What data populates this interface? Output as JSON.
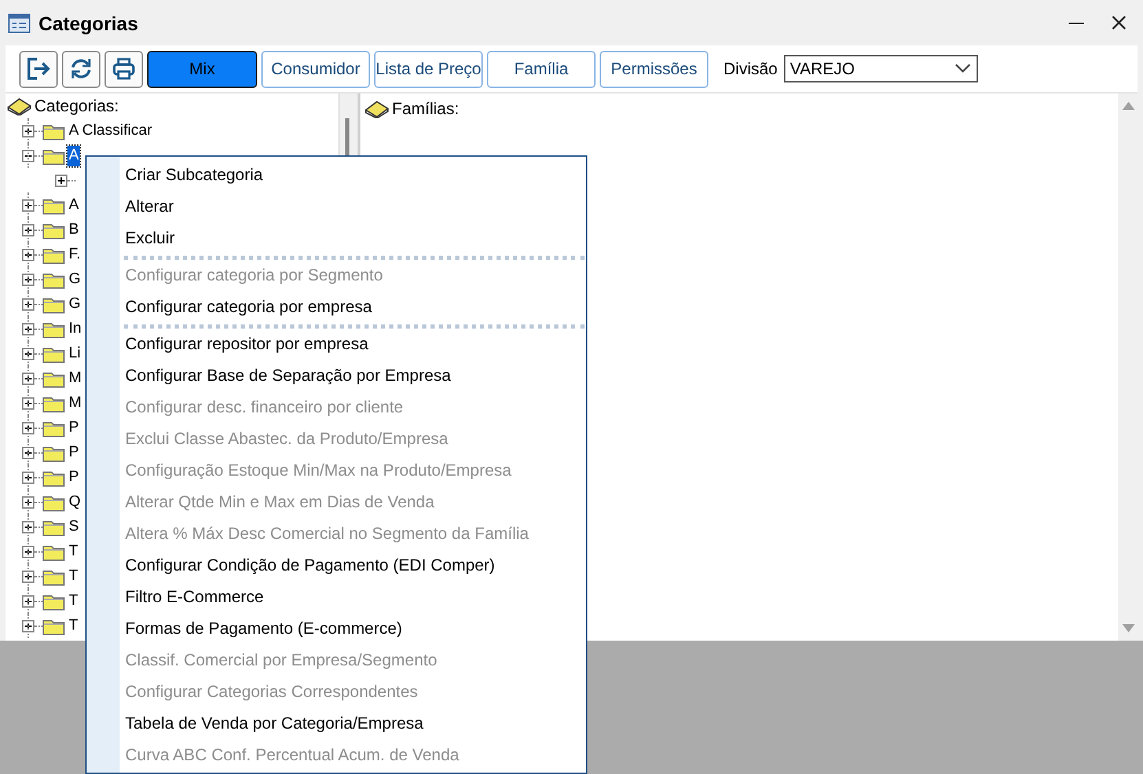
{
  "window": {
    "title": "Categorias"
  },
  "toolbar": {
    "buttons": [
      {
        "label": "Mix",
        "selected": true
      },
      {
        "label": "Consumidor",
        "selected": false
      },
      {
        "label": "Lista de Preço",
        "selected": false
      },
      {
        "label": "Família",
        "selected": false
      },
      {
        "label": "Permissões",
        "selected": false
      }
    ],
    "division": {
      "label": "Divisão",
      "value": "VAREJO"
    }
  },
  "tree": {
    "title": "Categorias:",
    "items": [
      {
        "label": "A Classificar",
        "expanded": false,
        "selected": false
      },
      {
        "label": "A",
        "expanded": true,
        "selected": true,
        "children": [
          {
            "expanded": false,
            "selected": false
          }
        ]
      },
      {
        "label": "A",
        "expanded": false,
        "selected": false
      },
      {
        "label": "B",
        "expanded": false,
        "selected": false
      },
      {
        "label": "F.",
        "expanded": false,
        "selected": false
      },
      {
        "label": "G",
        "expanded": false,
        "selected": false
      },
      {
        "label": "G",
        "expanded": false,
        "selected": false
      },
      {
        "label": "In",
        "expanded": false,
        "selected": false
      },
      {
        "label": "Li",
        "expanded": false,
        "selected": false
      },
      {
        "label": "M",
        "expanded": false,
        "selected": false
      },
      {
        "label": "M",
        "expanded": false,
        "selected": false
      },
      {
        "label": "P",
        "expanded": false,
        "selected": false
      },
      {
        "label": "P",
        "expanded": false,
        "selected": false
      },
      {
        "label": "P",
        "expanded": false,
        "selected": false
      },
      {
        "label": "Q",
        "expanded": false,
        "selected": false
      },
      {
        "label": "S",
        "expanded": false,
        "selected": false
      },
      {
        "label": "T",
        "expanded": false,
        "selected": false
      },
      {
        "label": "T",
        "expanded": false,
        "selected": false
      },
      {
        "label": "T",
        "expanded": false,
        "selected": false
      },
      {
        "label": "T",
        "expanded": false,
        "selected": false
      }
    ]
  },
  "families": {
    "title": "Famílias:"
  },
  "context_menu": {
    "items": [
      {
        "kind": "item",
        "label": "Criar Subcategoria",
        "disabled": false
      },
      {
        "kind": "item",
        "label": "Alterar",
        "disabled": false
      },
      {
        "kind": "item",
        "label": "Excluir",
        "disabled": false
      },
      {
        "kind": "separator"
      },
      {
        "kind": "item",
        "label": "Configurar categoria por Segmento",
        "disabled": true
      },
      {
        "kind": "item",
        "label": "Configurar categoria por empresa",
        "disabled": false
      },
      {
        "kind": "separator"
      },
      {
        "kind": "item",
        "label": "Configurar repositor por empresa",
        "disabled": false
      },
      {
        "kind": "item",
        "label": "Configurar Base de Separação por Empresa",
        "disabled": false
      },
      {
        "kind": "item",
        "label": "Configurar desc. financeiro por cliente",
        "disabled": true
      },
      {
        "kind": "item",
        "label": "Exclui Classe Abastec. da Produto/Empresa",
        "disabled": true
      },
      {
        "kind": "item",
        "label": "Configuração Estoque Min/Max na Produto/Empresa",
        "disabled": true
      },
      {
        "kind": "item",
        "label": "Alterar Qtde Min e Max em Dias de Venda",
        "disabled": true
      },
      {
        "kind": "item",
        "label": "Altera % Máx Desc Comercial no Segmento da Família",
        "disabled": true
      },
      {
        "kind": "item",
        "label": "Configurar Condição de Pagamento (EDI Comper)",
        "disabled": false
      },
      {
        "kind": "item",
        "label": "Filtro E-Commerce",
        "disabled": false
      },
      {
        "kind": "item",
        "label": "Formas de Pagamento (E-commerce)",
        "disabled": false
      },
      {
        "kind": "item",
        "label": "Classif. Comercial por Empresa/Segmento",
        "disabled": true
      },
      {
        "kind": "item",
        "label": "Configurar Categorias Correspondentes",
        "disabled": true
      },
      {
        "kind": "item",
        "label": "Tabela de Venda por Categoria/Empresa",
        "disabled": false
      },
      {
        "kind": "item",
        "label": "Curva ABC Conf. Percentual Acum. de Venda",
        "disabled": true
      }
    ]
  }
}
